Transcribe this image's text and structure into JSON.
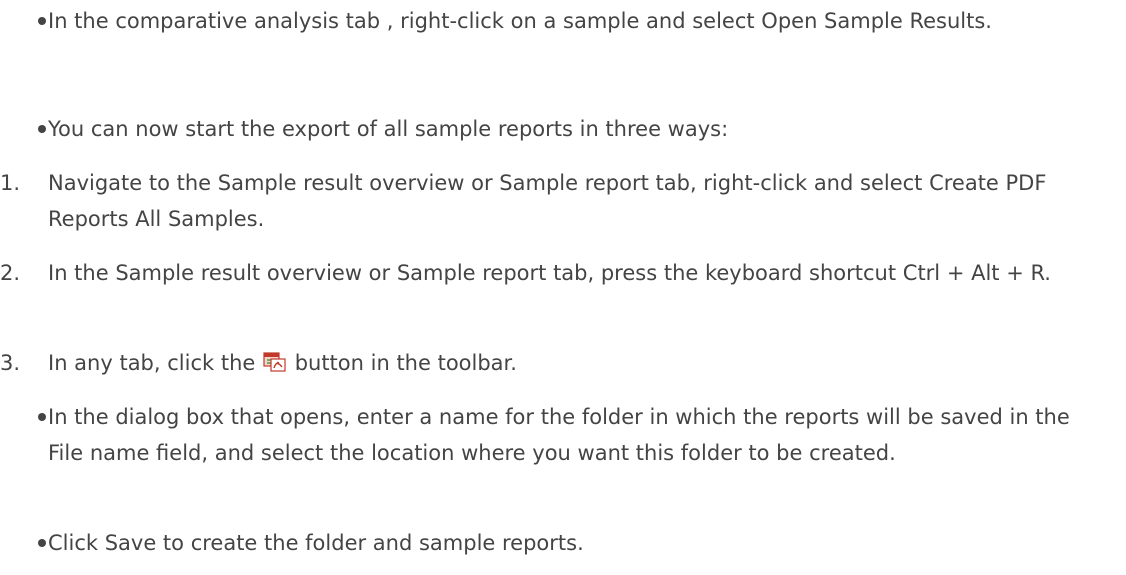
{
  "steps": {
    "b1": "In the comparative analysis tab , right-click on a sample and select Open Sample Results.",
    "b2": "You can now start the export of all sample reports in three ways:",
    "n1_marker": "1.",
    "n1": "Navigate to the Sample result overview or Sample report tab, right-click and select Create PDF Reports All Samples.",
    "n2_marker": "2.",
    "n2": "In the Sample result overview or Sample report tab, press the keyboard shortcut Ctrl + Alt + R.",
    "n3_marker": "3.",
    "n3_before": "In any tab, click the",
    "n3_icon": "pdf-reports-icon",
    "n3_after": "button in the toolbar.",
    "b3": "In the dialog box that opens, enter a name for the folder in which the reports will be saved in the File name field, and select the location where you want this folder to be created.",
    "b4": "Click Save to create the folder and sample reports."
  },
  "colors": {
    "text": "#444444",
    "icon_red": "#c0392b",
    "icon_green": "#4a9b3d"
  }
}
